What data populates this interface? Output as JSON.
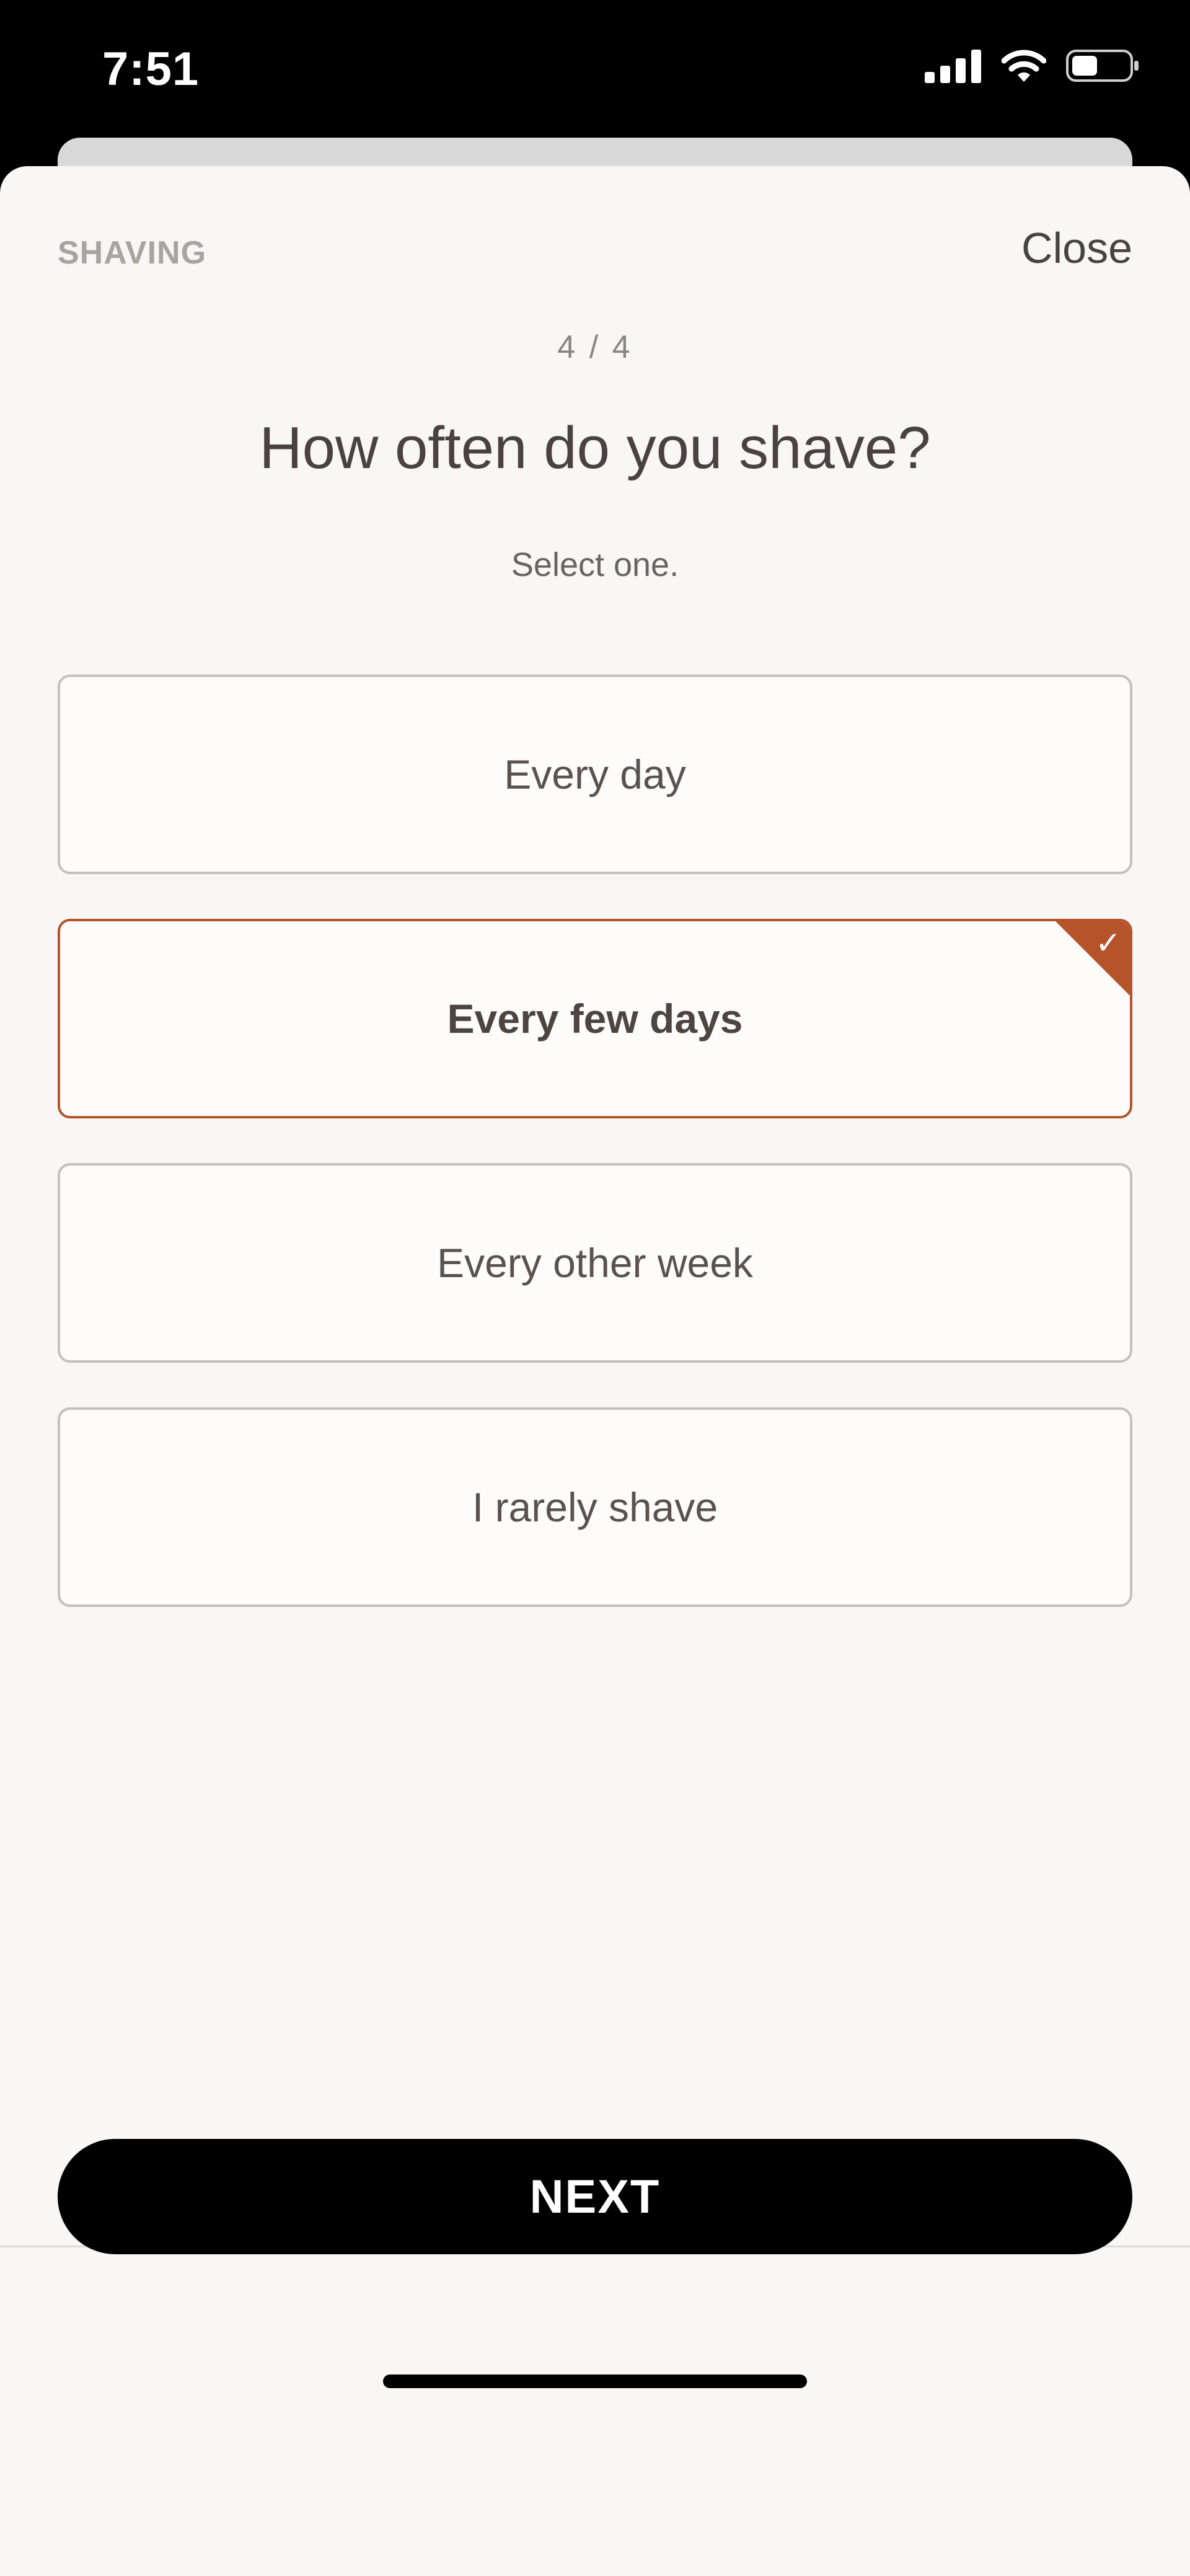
{
  "status_bar": {
    "time": "7:51",
    "icons": [
      "cellular-signal-icon",
      "wifi-icon",
      "battery-icon"
    ]
  },
  "header": {
    "section_label": "SHAVING",
    "close_label": "Close"
  },
  "progress": {
    "label": "4 / 4"
  },
  "question": {
    "title": "How often do you shave?",
    "instruction": "Select one."
  },
  "options": [
    {
      "label": "Every day",
      "selected": false
    },
    {
      "label": "Every few days",
      "selected": true
    },
    {
      "label": "Every other week",
      "selected": false
    },
    {
      "label": "I rarely shave",
      "selected": false
    }
  ],
  "footer": {
    "next_label": "NEXT"
  },
  "colors": {
    "accent": "#b5532b",
    "background": "#f8f7f5",
    "button": "#000000",
    "text": "#4a4240"
  }
}
